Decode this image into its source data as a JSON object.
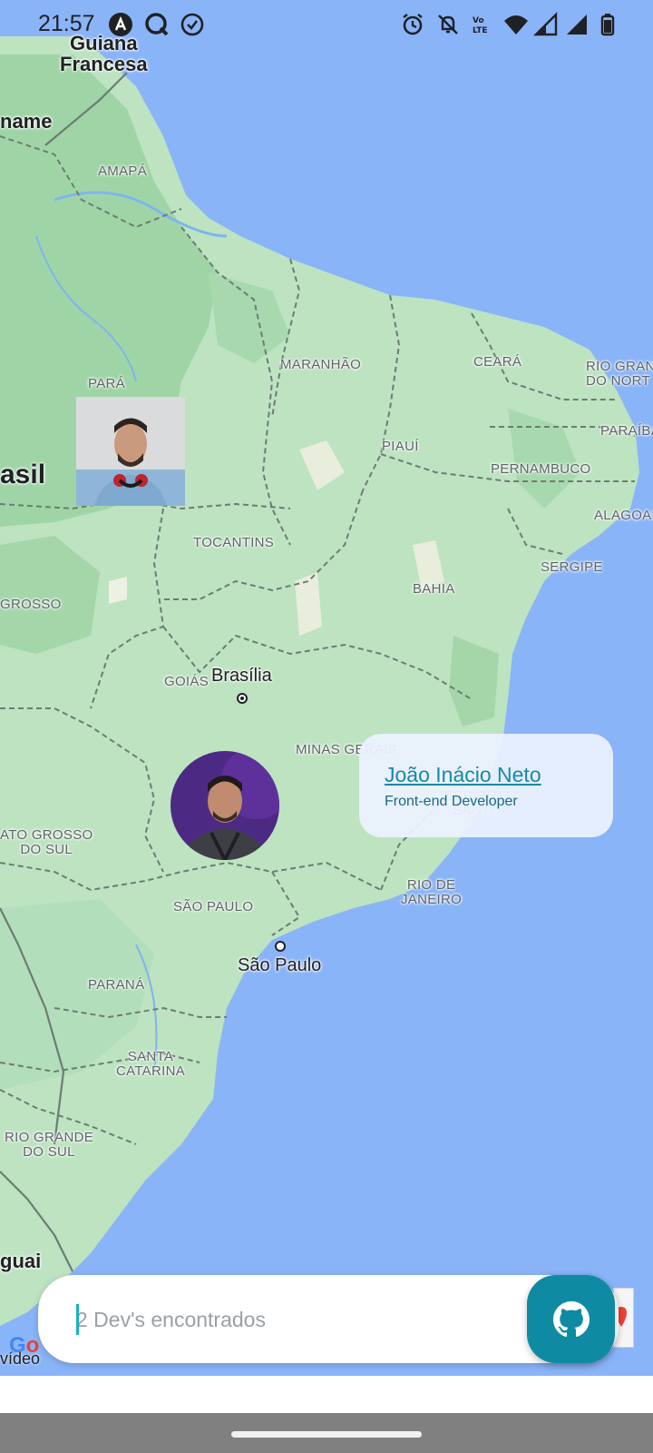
{
  "status_bar": {
    "time": "21:57",
    "left_icons": [
      "app-a-icon",
      "app-q-icon",
      "app-check-icon"
    ],
    "right_icons": [
      "alarm-icon",
      "notifications-off-icon",
      "volte-icon",
      "wifi-icon",
      "signal-icon",
      "signal-icon-2",
      "battery-icon"
    ]
  },
  "map": {
    "country_labels": [
      "Guiana\nFrancesa",
      "name",
      "asil",
      "guai"
    ],
    "state_labels": [
      "AMAPÁ",
      "PARÁ",
      "MARANHÃO",
      "CEARÁ",
      "RIO GRAND\nDO NORT",
      "PARAÍBA",
      "PIAUÍ",
      "PERNAMBUCO",
      "ALAGOAS",
      "SERGIPE",
      "TOCANTINS",
      "BAHIA",
      "GROSSO",
      "GOIÁS",
      "MINAS GERAIS",
      "ESPÍRITO\nSANTO",
      "ATO GROSSO\nDO SUL",
      "SÃO PAULO",
      "RIO DE\nJANEIRO",
      "PARANÁ",
      "SANTA\nCATARINA",
      "RIO GRANDE\nDO SUL"
    ],
    "city_labels": [
      "Brasília",
      "São Paulo"
    ],
    "colors": {
      "water": "#8ab4f8",
      "land": "#bde3c1",
      "forest": "#9fd5a6",
      "border": "#6b7d73"
    }
  },
  "callout": {
    "name": "João Inácio Neto",
    "role": "Front-end Developer"
  },
  "search": {
    "placeholder": "2 Dev's encontrados",
    "value": ""
  },
  "github_button": {
    "icon": "github-icon",
    "color": "#0e8ba2"
  },
  "attribution": {
    "logo": "Google",
    "partial_text": "vídeo"
  }
}
